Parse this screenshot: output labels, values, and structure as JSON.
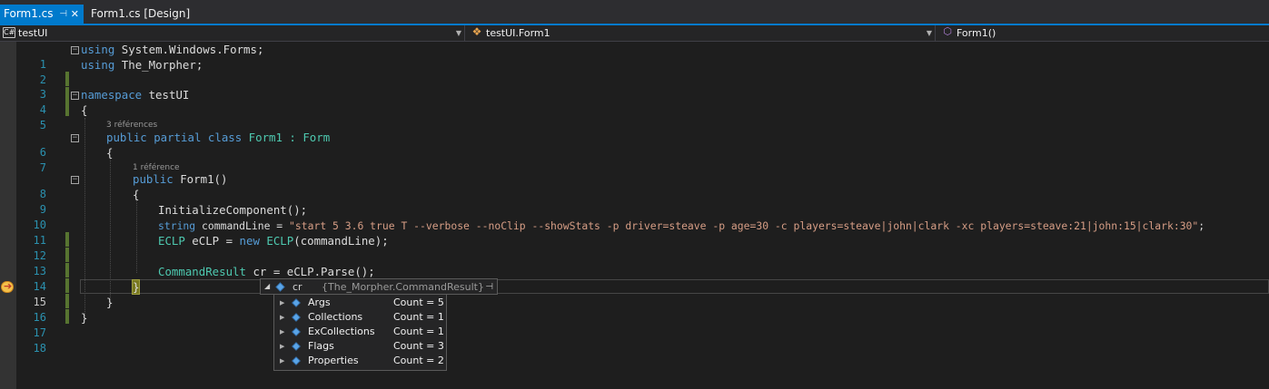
{
  "tabs": {
    "active": "Form1.cs",
    "active_pin": "⊣",
    "active_close": "✕",
    "design": "Form1.cs [Design]"
  },
  "navbar": {
    "project": "testUI",
    "class": "testUI.Form1",
    "member": "Form1()"
  },
  "lines": [
    {
      "num": "1"
    },
    {
      "num": "2"
    },
    {
      "num": "3"
    },
    {
      "num": "4"
    },
    {
      "num": "5"
    },
    {
      "num": "6"
    },
    {
      "num": "7"
    },
    {
      "num": "8"
    },
    {
      "num": "9"
    },
    {
      "num": "10"
    },
    {
      "num": "11"
    },
    {
      "num": "12"
    },
    {
      "num": "13"
    },
    {
      "num": "14"
    },
    {
      "num": "15"
    },
    {
      "num": "16"
    },
    {
      "num": "17"
    },
    {
      "num": "18"
    }
  ],
  "code": {
    "l1_kw": "using",
    "l1_rest": " System.Windows.Forms;",
    "l2_kw": "using",
    "l2_rest": " The_Morpher;",
    "l4_kw": "namespace",
    "l4_rest": " testUI",
    "l5": "{",
    "lens_class": "3 références",
    "l6_kw": "public partial class",
    "l6_name": " Form1 : ",
    "l6_base": "Form",
    "l7": "{",
    "lens_ctor": "1 référence",
    "l8_kw": "public",
    "l8_rest": " Form1()",
    "l9": "{",
    "l10": "InitializeComponent();",
    "l11_kw": "string",
    "l11_mid": " commandLine = ",
    "l11_str": "\"start 5 3.6 true T --verbose --noClip --showStats -p driver=steave -p age=30 -c players=steave|john|clark -xc players=steave:21|john:15|clark:30\"",
    "l11_end": ";",
    "l12_ty": "ECLP",
    "l12_mid": " eCLP = ",
    "l12_kw": "new",
    "l12_ty2": " ECLP",
    "l12_end": "(commandLine);",
    "l14_ty": "CommandResult",
    "l14_rest": " cr = eCLP.Parse();",
    "l15": "}",
    "l16": "}",
    "l17": "}"
  },
  "datatip": {
    "expander": "◢",
    "name": "cr",
    "value": "{The_Morpher.CommandResult}",
    "pin": "⊣"
  },
  "children": [
    {
      "name": "Args",
      "value": "Count = 5"
    },
    {
      "name": "Collections",
      "value": "Count = 1"
    },
    {
      "name": "ExCollections",
      "value": "Count = 1"
    },
    {
      "name": "Flags",
      "value": "Count = 3"
    },
    {
      "name": "Properties",
      "value": "Count = 2"
    }
  ],
  "colors": {
    "accent": "#007acc",
    "keyword": "#569cd6",
    "type": "#4ec9b0",
    "string": "#d69d85",
    "line_number": "#2b91af"
  },
  "icons": {
    "project": "csharp-project-icon",
    "class": "class-icon",
    "member": "method-icon",
    "execution": "execution-pointer-icon"
  }
}
